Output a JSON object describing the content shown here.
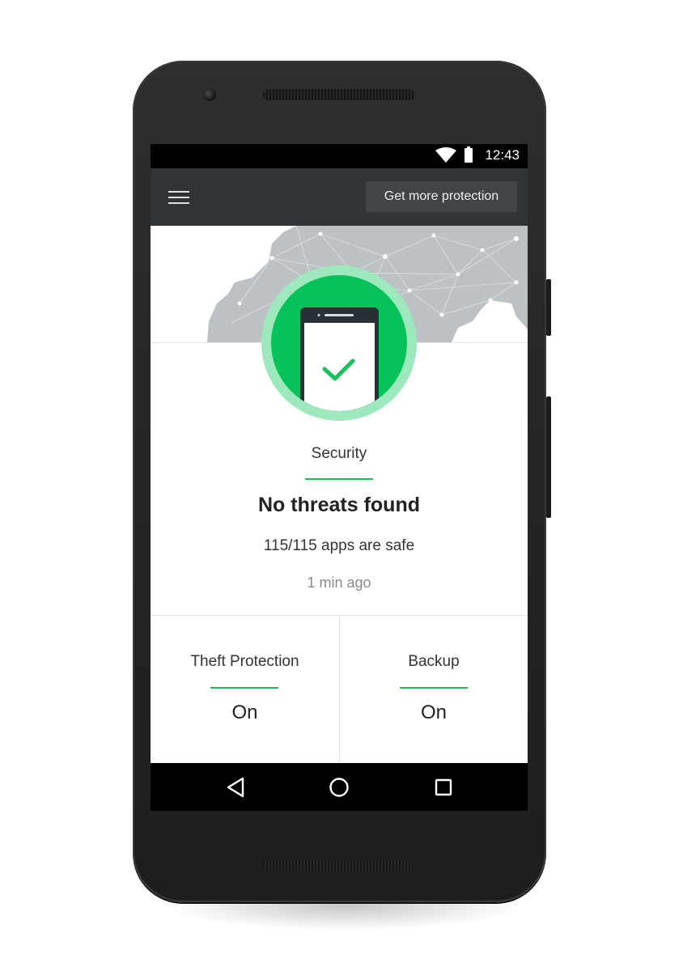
{
  "status_bar": {
    "time": "12:43"
  },
  "app_bar": {
    "menu_icon": "hamburger-menu-icon",
    "promo_button_label": "Get more protection"
  },
  "security": {
    "label": "Security",
    "title": "No threats found",
    "subtitle": "115/115 apps are safe",
    "last_scan": "1 min ago",
    "status_icon": "phone-check-icon",
    "colors": {
      "accent": "#1cbf5a",
      "circle": "#06c259",
      "ring": "#9ee8be"
    }
  },
  "cards": [
    {
      "label": "Theft Protection",
      "value": "On"
    },
    {
      "label": "Backup",
      "value": "On"
    }
  ],
  "nav": {
    "back_icon": "back-triangle-icon",
    "home_icon": "home-circle-icon",
    "recent_icon": "recent-square-icon"
  },
  "theme": {
    "app_bar": "#2f3437",
    "status_bar": "#000000"
  }
}
